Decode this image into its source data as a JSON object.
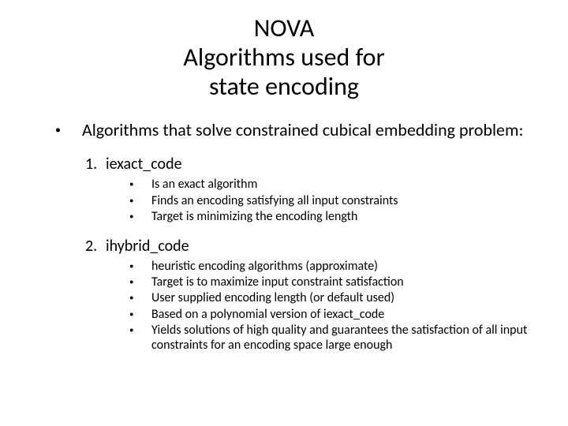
{
  "title_line1": "NOVA",
  "title_line2": "Algorithms used for",
  "title_line3": "state encoding",
  "intro": "Algorithms that solve constrained cubical embedding problem:",
  "sections": [
    {
      "num": "1.",
      "label": "iexact_code",
      "points": [
        "Is an exact algorithm",
        "Finds an encoding satisfying all input constraints",
        "Target is minimizing the encoding length"
      ]
    },
    {
      "num": "2.",
      "label": "ihybrid_code",
      "points": [
        "heuristic encoding algorithms (approximate)",
        "Target is to maximize input constraint satisfaction",
        "User supplied encoding length (or default used)",
        "Based on a polynomial version of iexact_code",
        "Yields solutions of high quality and guarantees the satisfaction of all input constraints for an encoding space large enough"
      ]
    }
  ]
}
